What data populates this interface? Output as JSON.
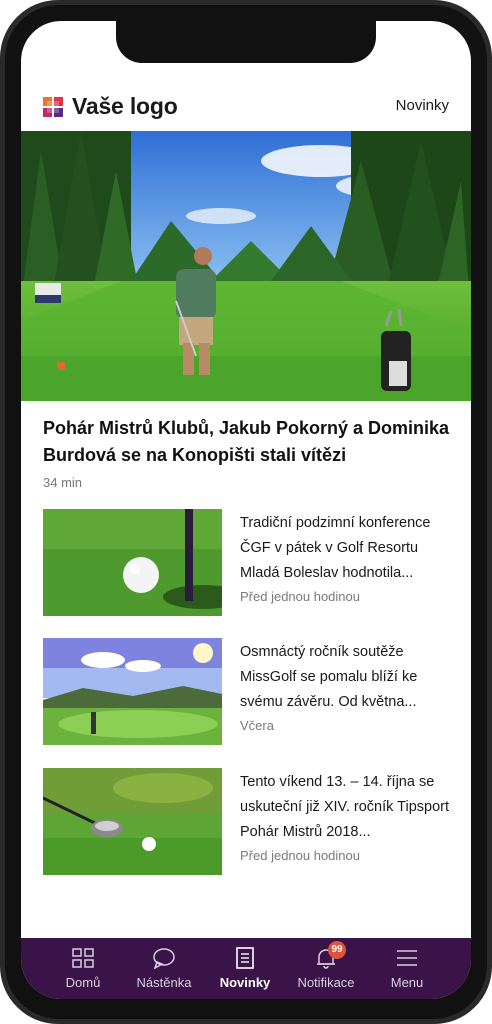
{
  "header": {
    "logo_text": "Vaše logo",
    "nav_link": "Novinky"
  },
  "featured": {
    "title": "Pohár Mistrů Klubů, Jakub Pokorný a Dominika Burdová se na Konopišti stali vítězi",
    "time": "34 min"
  },
  "news": [
    {
      "text": "Tradiční podzimní konference ČGF v pátek v Golf Resortu Mladá Boleslav hodnotila...",
      "time": "Před jednou hodinou"
    },
    {
      "text": "Osmnáctý ročník soutěže MissGolf se pomalu blíží ke svému závěru. Od května...",
      "time": "Včera"
    },
    {
      "text": "Tento víkend 13. – 14. října se uskuteční již XIV. ročník Tipsport Pohár Mistrů 2018...",
      "time": "Před jednou hodinou"
    }
  ],
  "tabbar": {
    "accent": "#3a1448",
    "badge_color": "#e0533a",
    "items": [
      {
        "label": "Domů",
        "icon": "grid-icon"
      },
      {
        "label": "Nástěnka",
        "icon": "chat-bubble-icon"
      },
      {
        "label": "Novinky",
        "icon": "document-icon",
        "active": true
      },
      {
        "label": "Notifikace",
        "icon": "bell-icon",
        "badge": "99"
      },
      {
        "label": "Menu",
        "icon": "hamburger-icon"
      }
    ]
  }
}
